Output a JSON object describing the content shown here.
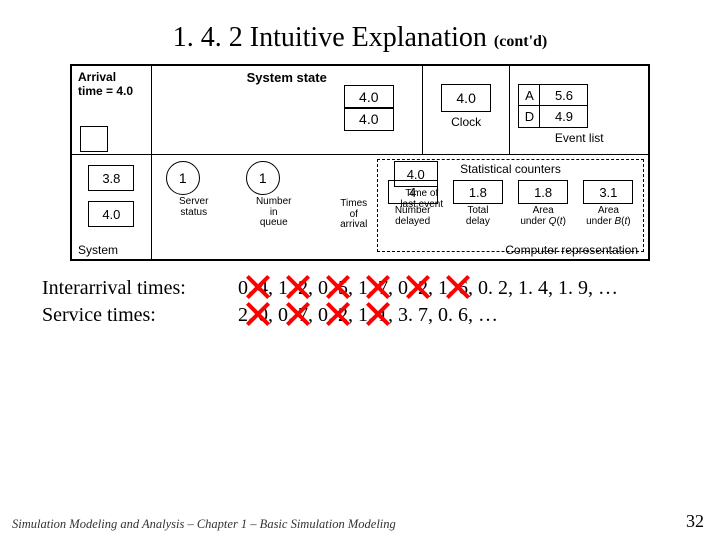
{
  "title_main": "1. 4. 2  Intuitive Explanation",
  "title_contd": "(cont'd)",
  "diagram": {
    "arrival_label_l1": "Arrival",
    "arrival_label_l2": "time = 4.0",
    "system_state_title": "System state",
    "clock_value": "4.0",
    "clock_label": "Clock",
    "event_list_label": "Event list",
    "events": {
      "A": "5.6",
      "D": "4.9",
      "A_label": "A",
      "D_label": "D"
    },
    "server_status": "1",
    "number_in_queue": "1",
    "times_of_arrival": [
      "4.0",
      "4.0"
    ],
    "sub_server": "Server\nstatus",
    "sub_niq": "Number\nin\nqueue",
    "sub_toa": "Times\nof\narrival",
    "sub_tle": "Time of\nlast event",
    "left_boxes": [
      "3.8",
      "4.0"
    ],
    "left_boxes_label": "System",
    "stats_title": "Statistical counters",
    "stats": {
      "number_delayed": "4",
      "total_delay": "1.8",
      "area_q": "1.8",
      "area_b": "3.1"
    },
    "stats_labels": {
      "nd": "Number\ndelayed",
      "td": "Total\ndelay",
      "aq_l1": "Area",
      "aq_l2": "under Q(t)",
      "ab_l1": "Area",
      "ab_l2": "under B(t)"
    },
    "computer_rep": "Computer representation"
  },
  "times": {
    "interarrival_label": "Interarrival times:",
    "service_label": "Service times:",
    "interarrival_values": "0. 4, 1. 2, 0. 5, 1. 7, 0. 2, 1. 6, 0. 2, 1. 4, 1. 9, …",
    "service_values": "2. 0, 0. 7, 0. 2, 1. 1, 3. 7, 0. 6, …"
  },
  "footer": "Simulation Modeling and Analysis – Chapter 1 –  Basic Simulation Modeling",
  "page_number": "32"
}
